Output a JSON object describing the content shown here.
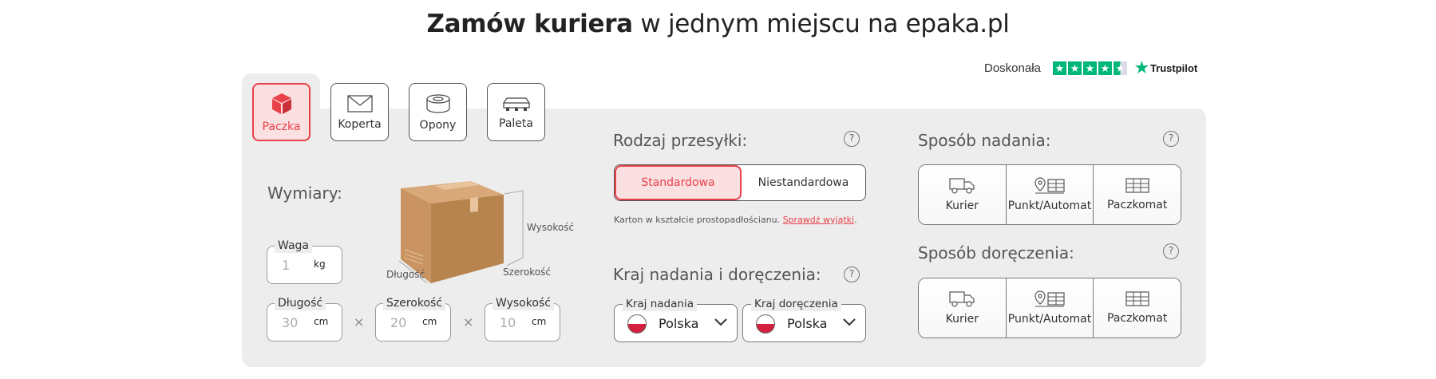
{
  "headline": {
    "bold": "Zamów kuriera",
    "rest": " w jednym miejscu na epaka.pl"
  },
  "rating": {
    "label": "Doskonała",
    "brand": "Trustpilot",
    "stars": 4.5
  },
  "package_types": [
    {
      "label": "Paczka",
      "icon": "box-icon",
      "active": true
    },
    {
      "label": "Koperta",
      "icon": "envelope-icon",
      "active": false
    },
    {
      "label": "Opony",
      "icon": "tire-icon",
      "active": false
    },
    {
      "label": "Paleta",
      "icon": "pallet-icon",
      "active": false
    }
  ],
  "dimensions": {
    "title": "Wymiary:",
    "weight": {
      "label": "Waga",
      "placeholder": "1",
      "unit": "kg"
    },
    "length": {
      "label": "Długość",
      "placeholder": "30",
      "unit": "cm"
    },
    "width": {
      "label": "Szerokość",
      "placeholder": "20",
      "unit": "cm"
    },
    "height": {
      "label": "Wysokość",
      "placeholder": "10",
      "unit": "cm"
    },
    "times": "×",
    "illustration": {
      "height": "Wysokość",
      "length": "Długość",
      "width": "Szerokość"
    }
  },
  "shipment_type": {
    "title": "Rodzaj przesyłki:",
    "options": [
      "Standardowa",
      "Niestandardowa"
    ],
    "selected": "Standardowa",
    "note": "Karton w kształcie prostopadłościanu.",
    "note_link": "Sprawdź wyjątki",
    "note_end": "."
  },
  "countries": {
    "title": "Kraj nadania i doręczenia:",
    "origin": {
      "label": "Kraj nadania",
      "value": "Polska"
    },
    "destination": {
      "label": "Kraj doręczenia",
      "value": "Polska"
    }
  },
  "send_method": {
    "title": "Sposób nadania:",
    "options": [
      "Kurier",
      "Punkt/Automat",
      "Paczkomat"
    ]
  },
  "delivery_method": {
    "title": "Sposób doręczenia:",
    "options": [
      "Kurier",
      "Punkt/Automat",
      "Paczkomat"
    ]
  },
  "help_symbol": "?",
  "colors": {
    "accent": "#e8414a",
    "accent_bg": "#fbe0e1",
    "panel": "#ededed",
    "trustpilot": "#00b67a"
  }
}
